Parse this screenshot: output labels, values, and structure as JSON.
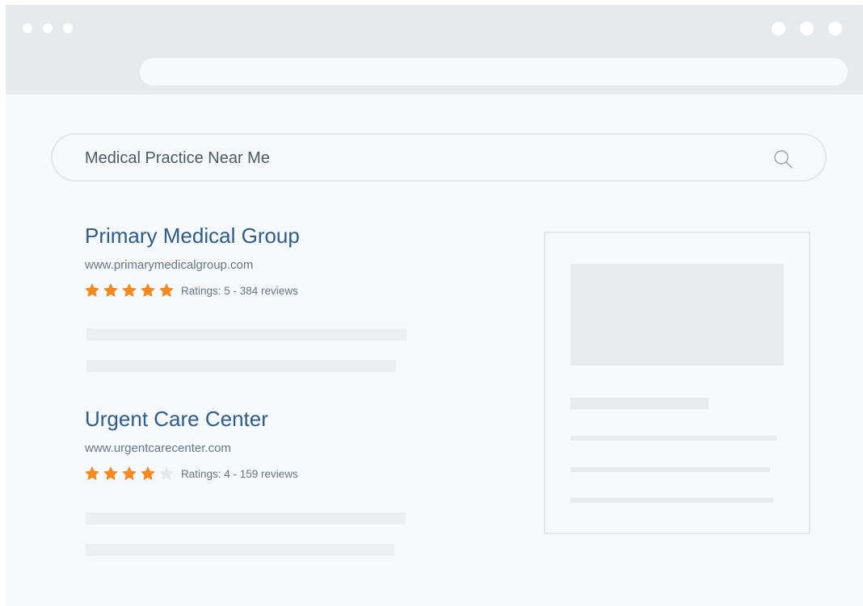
{
  "search": {
    "query": "Medical Practice Near Me",
    "icon": "search-icon"
  },
  "results": [
    {
      "title": "Primary Medical Group",
      "url": "www.primarymedicalgroup.com",
      "stars": 5,
      "max_stars": 5,
      "rating_text": "Ratings: 5 - 384 reviews"
    },
    {
      "title": "Urgent Care Center",
      "url": "www.urgentcarecenter.com",
      "stars": 4,
      "max_stars": 5,
      "rating_text": "Ratings: 4 - 159 reviews"
    }
  ],
  "colors": {
    "title": "#2f5b8a",
    "star_filled": "#f5891f",
    "star_empty": "#e6e9ec",
    "titlebar": "#e7eaed",
    "page_bg": "#f6f9fb"
  }
}
